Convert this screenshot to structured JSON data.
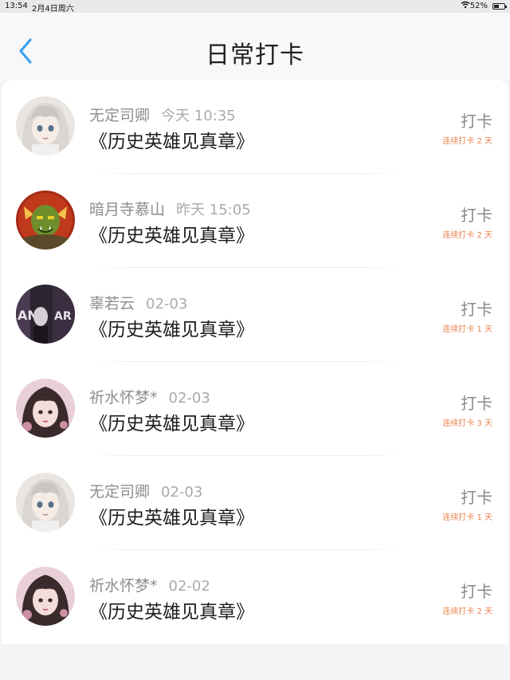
{
  "status_bar": {
    "time": "13:54",
    "date": "2月4日周六",
    "wifi_icon": "wifi-icon",
    "battery": "52%",
    "battery_level": 0.52
  },
  "nav": {
    "back_icon": "chevron-left-icon",
    "title": "日常打卡",
    "accent": "#3b9ff0"
  },
  "checkins": [
    {
      "user": "无定司卿",
      "time": "今天 10:35",
      "book": "《历史英雄见真章》",
      "action": "打卡",
      "streak": "连续打卡 2 天",
      "avatar": "anime-white-hair"
    },
    {
      "user": "暗月寺慕山",
      "time": "昨天 15:05",
      "book": "《历史英雄见真章》",
      "action": "打卡",
      "streak": "连续打卡 2 天",
      "avatar": "orc-warrior"
    },
    {
      "user": "辜若云",
      "time": "02-03",
      "book": "《历史英雄见真章》",
      "action": "打卡",
      "streak": "连续打卡 1 天",
      "avatar": "dark-poster"
    },
    {
      "user": "祈水怀梦*",
      "time": "02-03",
      "book": "《历史英雄见真章》",
      "action": "打卡",
      "streak": "连续打卡 3 天",
      "avatar": "girl-portrait"
    },
    {
      "user": "无定司卿",
      "time": "02-03",
      "book": "《历史英雄见真章》",
      "action": "打卡",
      "streak": "连续打卡 1 天",
      "avatar": "anime-white-hair"
    },
    {
      "user": "祈水怀梦*",
      "time": "02-02",
      "book": "《历史英雄见真章》",
      "action": "打卡",
      "streak": "连续打卡 2 天",
      "avatar": "girl-portrait"
    }
  ],
  "colors": {
    "streak": "#e8834e",
    "background": "#f4f4f6"
  }
}
